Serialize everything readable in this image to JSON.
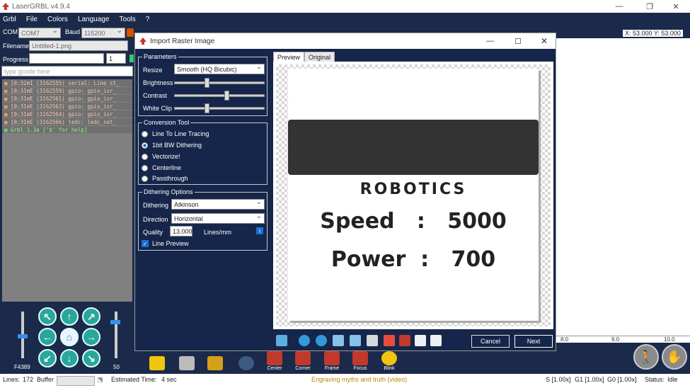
{
  "app": {
    "title": "LaserGRBL v4.9.4"
  },
  "menu": [
    "Grbl",
    "File",
    "Colors",
    "Language",
    "Tools",
    "?"
  ],
  "connection": {
    "com_label": "COM",
    "com_value": "COM7",
    "baud_label": "Baud",
    "baud_value": "115200"
  },
  "file": {
    "filename_label": "Filename",
    "filename_value": "Untitled-1.png",
    "progress_label": "Progress",
    "progress_copies": "1"
  },
  "gcode_input": {
    "placeholder": "type gcode here"
  },
  "console_lines": [
    "[0;32mI (3162555) serial: Line st_",
    "[0;31mE (3162559) gpio: gpio_isr_",
    "[0;31mE (3162561) gpio: gpio_isr_",
    "[0;31mE (3162563) gpio: gpio_isr_",
    "[0;31mE (3162564) gpio: gpio_isr_",
    "[0;31mE (3162566) ledc: ledc_set_"
  ],
  "console_ok": "Grbl 1.3a ['$' for help]",
  "jog": {
    "feed_label": "F4389",
    "step_label": "50"
  },
  "canvas": {
    "coords": "X: 53.000 Y: 53.000",
    "ruler_ticks": [
      "8.0",
      "9.0",
      "10.0"
    ]
  },
  "tools": [
    "Center",
    "Corner",
    "Frame",
    "Focus",
    "Blink"
  ],
  "status": {
    "lines_label": "Lines:",
    "lines_value": "172",
    "buffer_label": "Buffer",
    "estimated_label": "Estimated Time:",
    "estimated_value": "4 sec",
    "center_msg": "Engraving myths and truth (video)",
    "s_override": "S [1.00x]",
    "g1_override": "G1 [1.00x]",
    "g0_override": "G0 [1.00x]",
    "state_label": "Status:",
    "state_value": "Idle"
  },
  "dialog": {
    "title": "Import Raster Image",
    "parameters": {
      "title": "Parameters",
      "resize_label": "Resize",
      "resize_value": "Smooth (HQ Bicubic)",
      "brightness_label": "Brightness",
      "brightness": 0.35,
      "contrast_label": "Contrast",
      "contrast": 0.58,
      "whiteclip_label": "White Clip",
      "whiteclip": 0.35
    },
    "conversion": {
      "title": "Conversion Tool",
      "options": [
        "Line To Line Tracing",
        "1bit BW Dithering",
        "Vectorize!",
        "Centerline",
        "Passthrough"
      ],
      "selected": 1
    },
    "dithering": {
      "title": "Dithering Options",
      "dithering_label": "Dithering",
      "dithering_value": "Atkinson",
      "direction_label": "Direction",
      "direction_value": "Horizontal",
      "quality_label": "Quality",
      "quality_value": "13.000",
      "quality_unit": "Lines/mm",
      "line_preview_label": "Line Preview"
    },
    "tabs": [
      "Preview",
      "Original"
    ],
    "image": {
      "line1": "ROBOTICS",
      "line2": "Speed   :   5000",
      "line3": "Power  :   700"
    },
    "buttons": {
      "cancel": "Cancel",
      "next": "Next"
    }
  }
}
